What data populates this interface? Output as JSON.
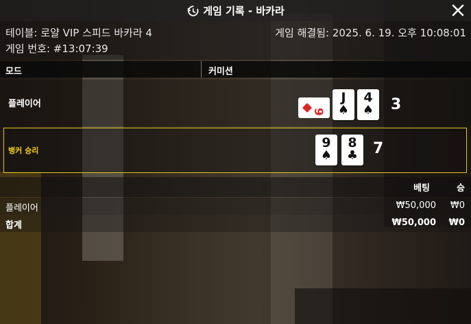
{
  "window": {
    "title": "게임 기록 - 바카라",
    "close_icon": "close-icon",
    "history_icon": "history-icon"
  },
  "info": {
    "table": "테이블: 로얄 VIP 스피드 바카라 4",
    "game_number": "게임 번호: #13:07:39",
    "resolved": "게임 해결됨: 2025. 6. 19. 오후 10:08:01"
  },
  "mode_bar": {
    "mode_label": "모드",
    "commission_label": "커미션"
  },
  "hands": {
    "player": {
      "label": "플레이어",
      "side_card": "rotated-diamond-9",
      "cards": [
        {
          "rank": "J",
          "suit": "♠"
        },
        {
          "rank": "4",
          "suit": "♠"
        }
      ],
      "score": "3"
    },
    "banker": {
      "label": "뱅커 승리",
      "cards": [
        {
          "rank": "9",
          "suit": "♠"
        },
        {
          "rank": "8",
          "suit": "♣"
        }
      ],
      "score": "7",
      "highlight_color": "#e8c51a"
    }
  },
  "bets": {
    "headers": {
      "bet": "베팅",
      "win": "승"
    },
    "rows": [
      {
        "name": "플레이어",
        "amount": "₩50,000",
        "win": "₩0"
      }
    ],
    "total": {
      "name": "합계",
      "amount": "₩50,000",
      "win": "₩0"
    }
  }
}
